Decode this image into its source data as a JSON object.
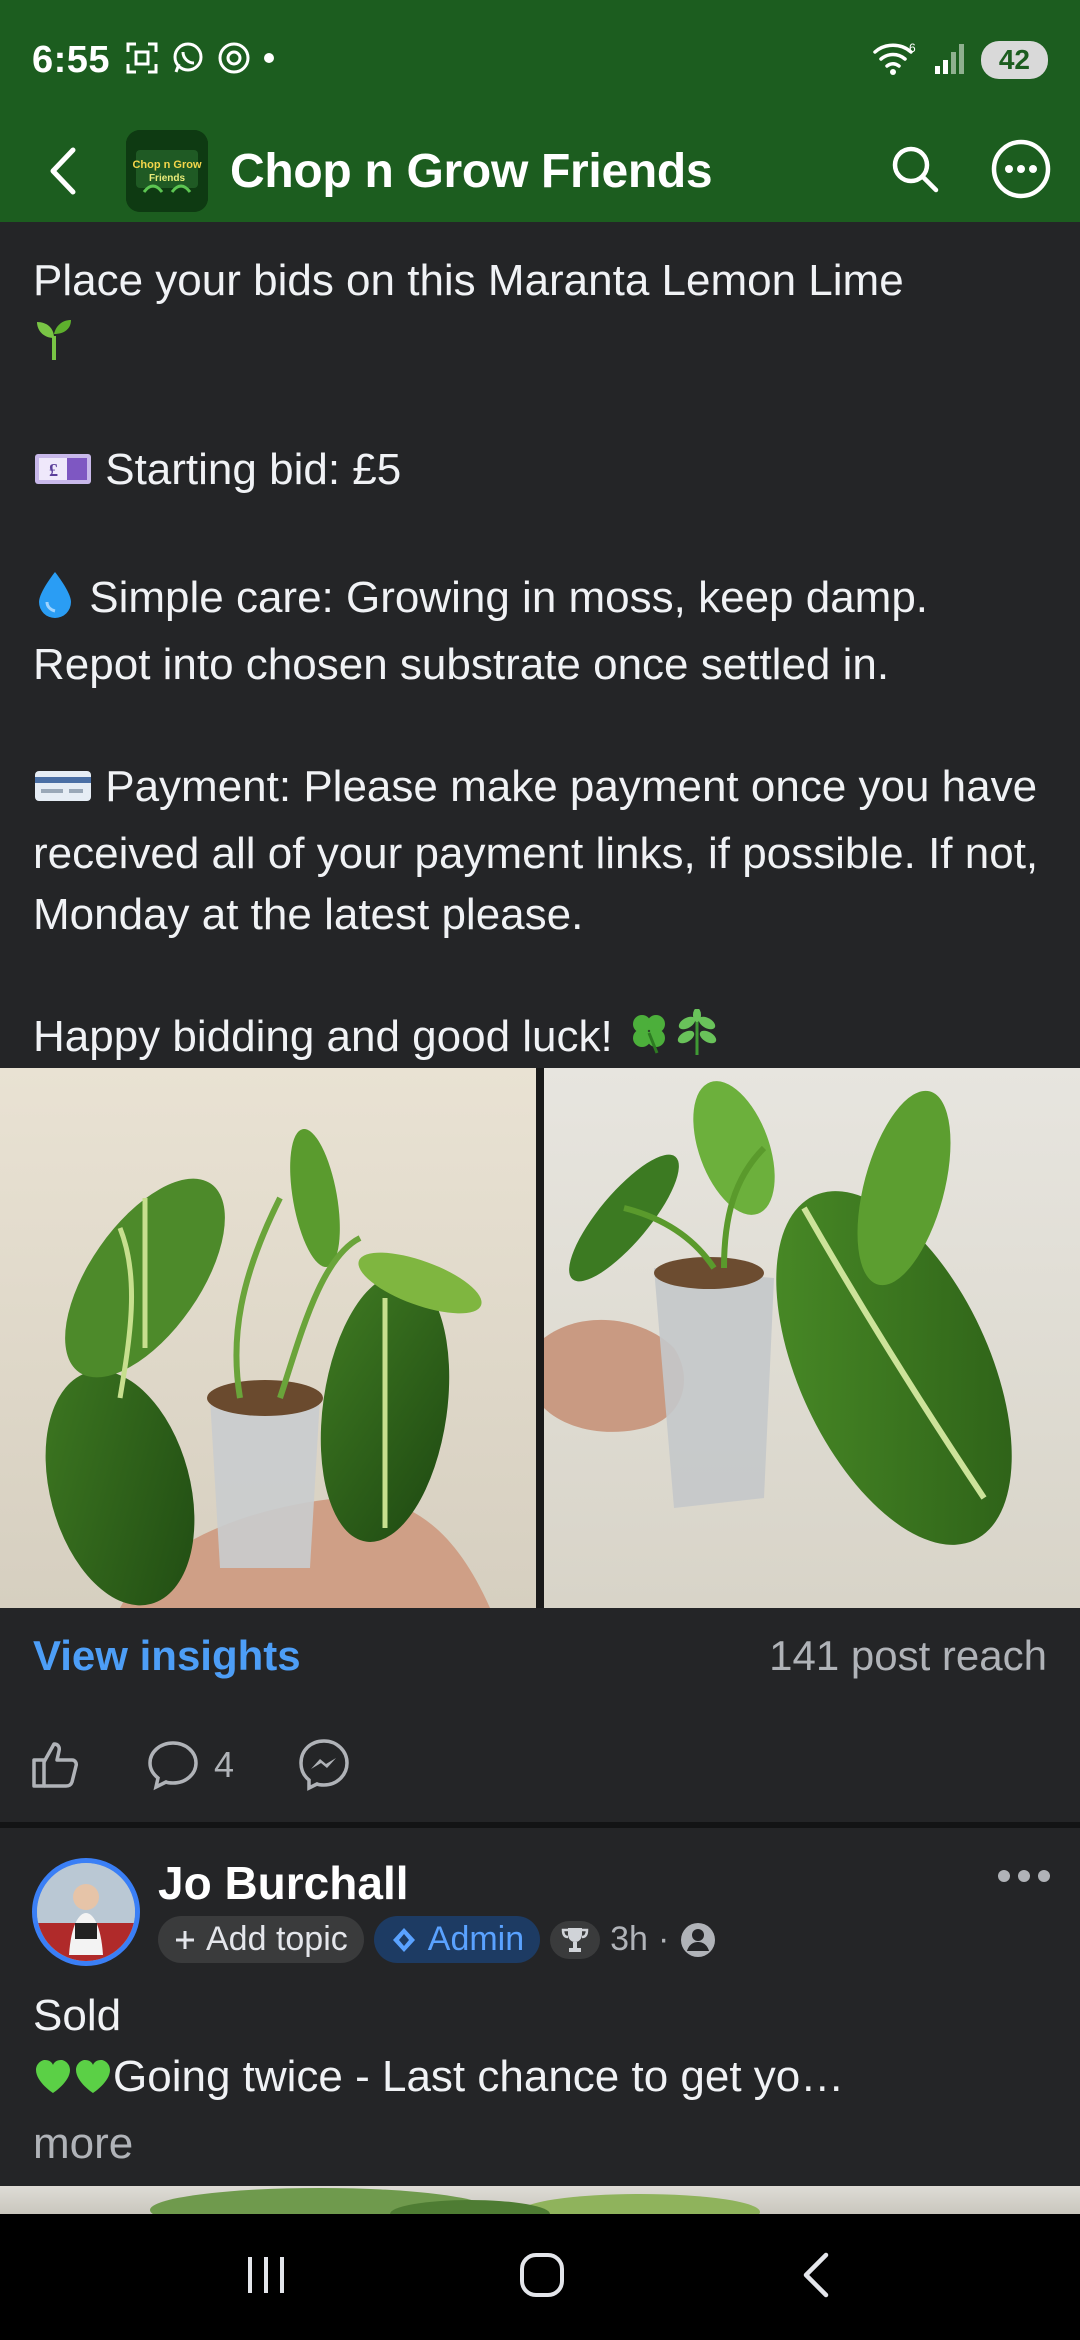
{
  "status_bar": {
    "time": "6:55",
    "signal_label": "6",
    "battery": "42"
  },
  "header": {
    "title": "Chop n Grow Friends",
    "logo_label": "Chop n Grow Friends"
  },
  "post": {
    "line1": "Place your bids on this Maranta Lemon Lime",
    "starting_bid": "Starting bid: £5",
    "care": "Simple care: Growing in moss, keep damp. Repot into chosen substrate once settled in.",
    "payment": "Payment: Please make payment once you have received all of your payment links, if possible. If not, Monday at the latest please.",
    "closing": "Happy bidding and good luck!",
    "view_insights": "View insights",
    "post_reach": "141 post reach",
    "comment_count": "4"
  },
  "next_post": {
    "author": "Jo Burchall",
    "add_topic": "Add topic",
    "admin_badge": "Admin",
    "time": "3h",
    "text_line1": "Sold",
    "text_line2": "Going twice - Last chance to get yo…",
    "more": "more"
  },
  "colors": {
    "brand_green": "#1c5d1f",
    "background": "#242527",
    "link_blue": "#4d9ef7"
  }
}
